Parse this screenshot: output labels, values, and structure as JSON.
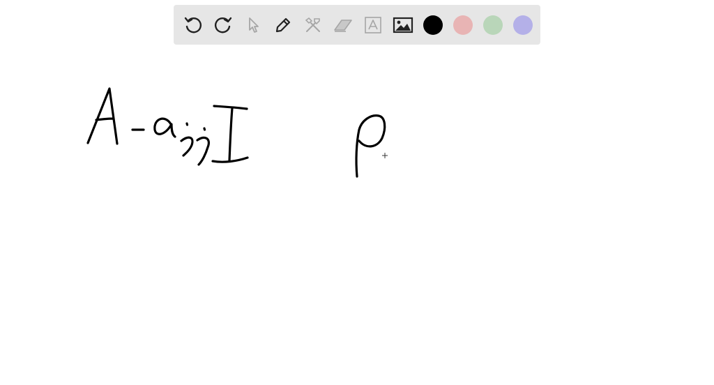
{
  "toolbar": {
    "tools": [
      {
        "name": "undo-icon",
        "enabled": true
      },
      {
        "name": "redo-icon",
        "enabled": true
      },
      {
        "name": "select-pointer-icon",
        "enabled": false
      },
      {
        "name": "pen-icon",
        "enabled": true
      },
      {
        "name": "tools-icon",
        "enabled": false
      },
      {
        "name": "eraser-icon",
        "enabled": false
      },
      {
        "name": "text-icon",
        "enabled": false
      },
      {
        "name": "image-icon",
        "enabled": true
      }
    ],
    "colors": [
      {
        "name": "black",
        "hex": "#000000",
        "selected": true
      },
      {
        "name": "red",
        "hex": "#e8b4b4"
      },
      {
        "name": "green",
        "hex": "#b9d6b9"
      },
      {
        "name": "purple",
        "hex": "#b4b0e8"
      }
    ],
    "icon_color": "#222222",
    "disabled_icon_color": "#a6a6a6"
  },
  "canvas": {
    "background": "#ffffff",
    "ink_color": "#000000",
    "cursor": "crosshair-cursor"
  }
}
